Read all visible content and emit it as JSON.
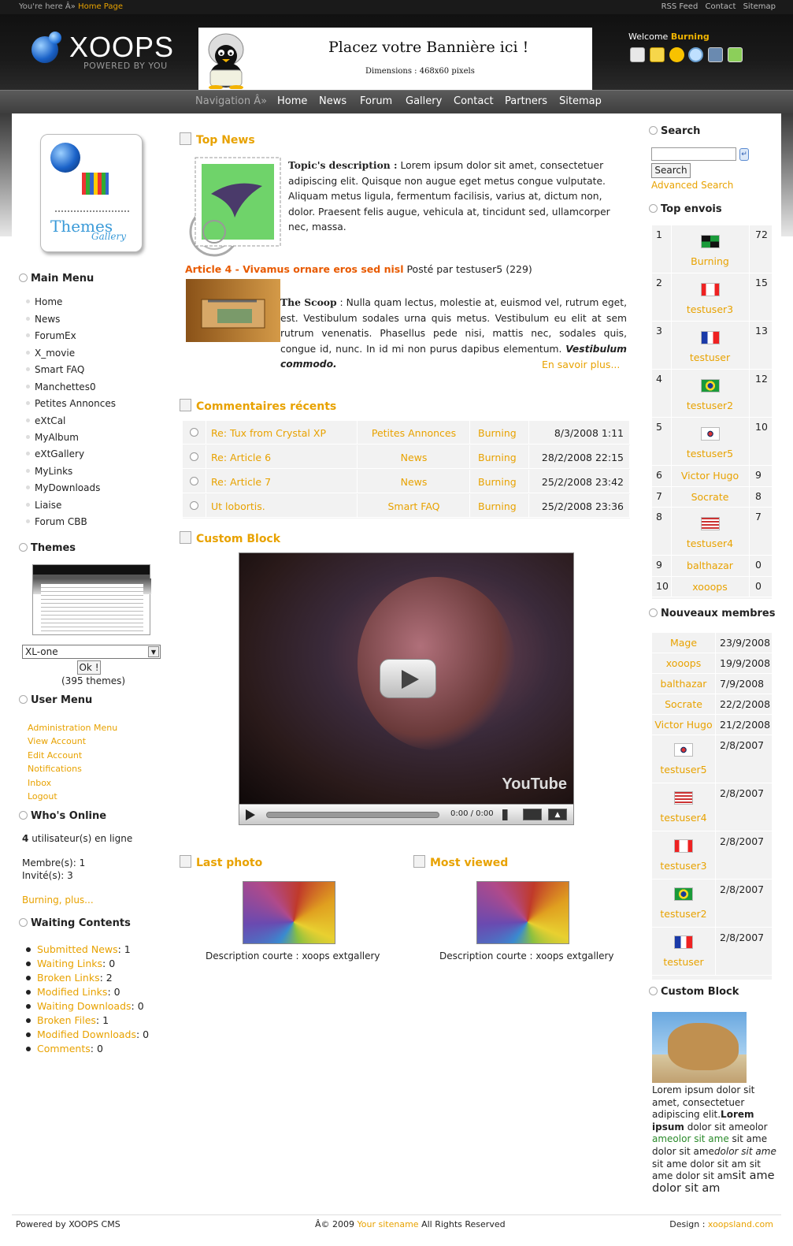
{
  "topbar": {
    "here": "You're here Â»",
    "home_link": "Home Page",
    "links": [
      "RSS Feed",
      "Contact",
      "Sitemap"
    ]
  },
  "logo": {
    "title": "XOOPS",
    "subtitle": "POWERED BY YOU"
  },
  "banner": {
    "line1": "Placez votre Bannière ici !",
    "line2": "Dimensions : 468x60 pixels"
  },
  "welcome": {
    "prefix": "Welcome",
    "user": "Burning"
  },
  "nav": {
    "label": "Navigation Â»",
    "items": [
      "Home",
      "News",
      "Forum",
      "Gallery",
      "Contact",
      "Partners",
      "Sitemap"
    ]
  },
  "left": {
    "main_menu_title": "Main Menu",
    "main_menu": [
      "Home",
      "News",
      "ForumEx",
      "X_movie",
      "Smart FAQ",
      "Manchettes0",
      "Petites Annonces",
      "eXtCal",
      "MyAlbum",
      "eXtGallery",
      "MyLinks",
      "MyDownloads",
      "Liaise",
      "Forum CBB"
    ],
    "themes_title": "Themes",
    "themes_select": "XL-one",
    "themes_ok": "Ok !",
    "themes_count": "(395 themes)",
    "themes_logo_text": "Themes",
    "themes_logo_sub": "Gallery",
    "user_menu_title": "User Menu",
    "user_menu": [
      "Administration Menu",
      "View Account",
      "Edit Account",
      "Notifications",
      "Inbox",
      "Logout"
    ],
    "online_title": "Who's Online",
    "online_count": "4",
    "online_text": "utilisateur(s) en ligne",
    "members": "Membre(s): 1",
    "guests": "Invité(s): 3",
    "online_user": "Burning,",
    "online_more": "plus...",
    "waiting_title": "Waiting Contents",
    "waiting": [
      {
        "label": "Submitted News",
        "count": ": 1"
      },
      {
        "label": "Waiting Links",
        "count": ": 0"
      },
      {
        "label": "Broken Links",
        "count": ": 2"
      },
      {
        "label": "Modified Links",
        "count": ": 0"
      },
      {
        "label": "Waiting Downloads",
        "count": ": 0"
      },
      {
        "label": "Broken Files",
        "count": ": 1"
      },
      {
        "label": "Modified Downloads",
        "count": ": 0"
      },
      {
        "label": "Comments",
        "count": ": 0"
      }
    ]
  },
  "center": {
    "top_news_title": "Top News",
    "topic_label": "Topic's description :",
    "topic_text": "Lorem ipsum dolor sit amet, consectetuer adipiscing elit. Quisque non augue eget metus congue vulputate. Aliquam metus ligula, fermentum facilisis, varius at, dictum non, dolor. Praesent felis augue, vehicula at, tincidunt sed, ullamcorper nec, massa.",
    "article_title": "Article 4 - Vivamus ornare eros sed nisl",
    "article_meta": "Posté par testuser5 (229)",
    "scoop_label": "The Scoop",
    "scoop_text": " : Nulla quam lectus, molestie at, euismod vel, rutrum eget, est. Vestibulum sodales urna quis metus. Vestibulum eu elit at sem rutrum venenatis. Phasellus pede nisi, mattis nec, sodales quis, congue id, nunc. In id mi non purus dapibus elementum. ",
    "scoop_em": "Vestibulum commodo.",
    "read_more": "En savoir plus...",
    "comments_title": "Commentaires récents",
    "comments": [
      {
        "title": "Re: Tux from Crystal XP",
        "module": "Petites Annonces",
        "user": "Burning",
        "date": "8/3/2008 1:11"
      },
      {
        "title": "Re: Article 6",
        "module": "News",
        "user": "Burning",
        "date": "28/2/2008 22:15"
      },
      {
        "title": "Re: Article 7",
        "module": "News",
        "user": "Burning",
        "date": "25/2/2008 23:42"
      },
      {
        "title": "Ut lobortis.",
        "module": "Smart FAQ",
        "user": "Burning",
        "date": "25/2/2008 23:36"
      }
    ],
    "custom_title": "Custom Block",
    "video_time": "0:00 / 0:00",
    "video_brand": "YouTube",
    "last_photo_title": "Last photo",
    "most_viewed_title": "Most viewed",
    "photo_desc": "Description courte : xoops extgallery"
  },
  "right": {
    "search_title": "Search",
    "search_button": "Search",
    "advanced": "Advanced Search",
    "top_title": "Top envois",
    "top": [
      {
        "rank": "1",
        "name": "Burning",
        "count": "72",
        "flag": "jm"
      },
      {
        "rank": "2",
        "name": "testuser3",
        "count": "15",
        "flag": "ca"
      },
      {
        "rank": "3",
        "name": "testuser",
        "count": "13",
        "flag": "fr"
      },
      {
        "rank": "4",
        "name": "testuser2",
        "count": "12",
        "flag": "br"
      },
      {
        "rank": "5",
        "name": "testuser5",
        "count": "10",
        "flag": "kr"
      },
      {
        "rank": "6",
        "name": "Victor Hugo",
        "count": "9",
        "flag": ""
      },
      {
        "rank": "7",
        "name": "Socrate",
        "count": "8",
        "flag": ""
      },
      {
        "rank": "8",
        "name": "testuser4",
        "count": "7",
        "flag": "us"
      },
      {
        "rank": "9",
        "name": "balthazar",
        "count": "0",
        "flag": ""
      },
      {
        "rank": "10",
        "name": "xooops",
        "count": "0",
        "flag": ""
      }
    ],
    "new_title": "Nouveaux membres",
    "new_members": [
      {
        "name": "Mage",
        "date": "23/9/2008",
        "flag": ""
      },
      {
        "name": "xooops",
        "date": "19/9/2008",
        "flag": ""
      },
      {
        "name": "balthazar",
        "date": "7/9/2008",
        "flag": ""
      },
      {
        "name": "Socrate",
        "date": "22/2/2008",
        "flag": ""
      },
      {
        "name": "Victor Hugo",
        "date": "21/2/2008",
        "flag": ""
      },
      {
        "name": "testuser5",
        "date": "2/8/2007",
        "flag": "kr"
      },
      {
        "name": "testuser4",
        "date": "2/8/2007",
        "flag": "us"
      },
      {
        "name": "testuser3",
        "date": "2/8/2007",
        "flag": "ca"
      },
      {
        "name": "testuser2",
        "date": "2/8/2007",
        "flag": "br"
      },
      {
        "name": "testuser",
        "date": "2/8/2007",
        "flag": "fr"
      }
    ],
    "custom_title": "Custom Block",
    "custom_t1": "Lorem ipsum dolor sit amet, consectetuer adipiscing elit.",
    "custom_t2": "Lorem ipsum",
    "custom_t3": " dolor sit ameolor ",
    "custom_t4": "ameolor sit ame",
    "custom_t5": " sit ame dolor sit ame",
    "custom_t6": "dolor sit ame",
    "custom_t7": " sit ame dolor sit am sit ame dolor sit am",
    "custom_t8": "sit ame dolor sit am"
  },
  "footer": {
    "powered": "Powered by",
    "xoops": "XOOPS",
    "cms": "CMS",
    "copy": "Â© 2009",
    "sitename": "Your sitename",
    "rights": "All Rights Reserved",
    "design": "Design :",
    "design_link": "xoopsland.com"
  },
  "colors": {
    "accent": "#e8a200",
    "header": "#111111",
    "nav": "#4a4a4a"
  }
}
